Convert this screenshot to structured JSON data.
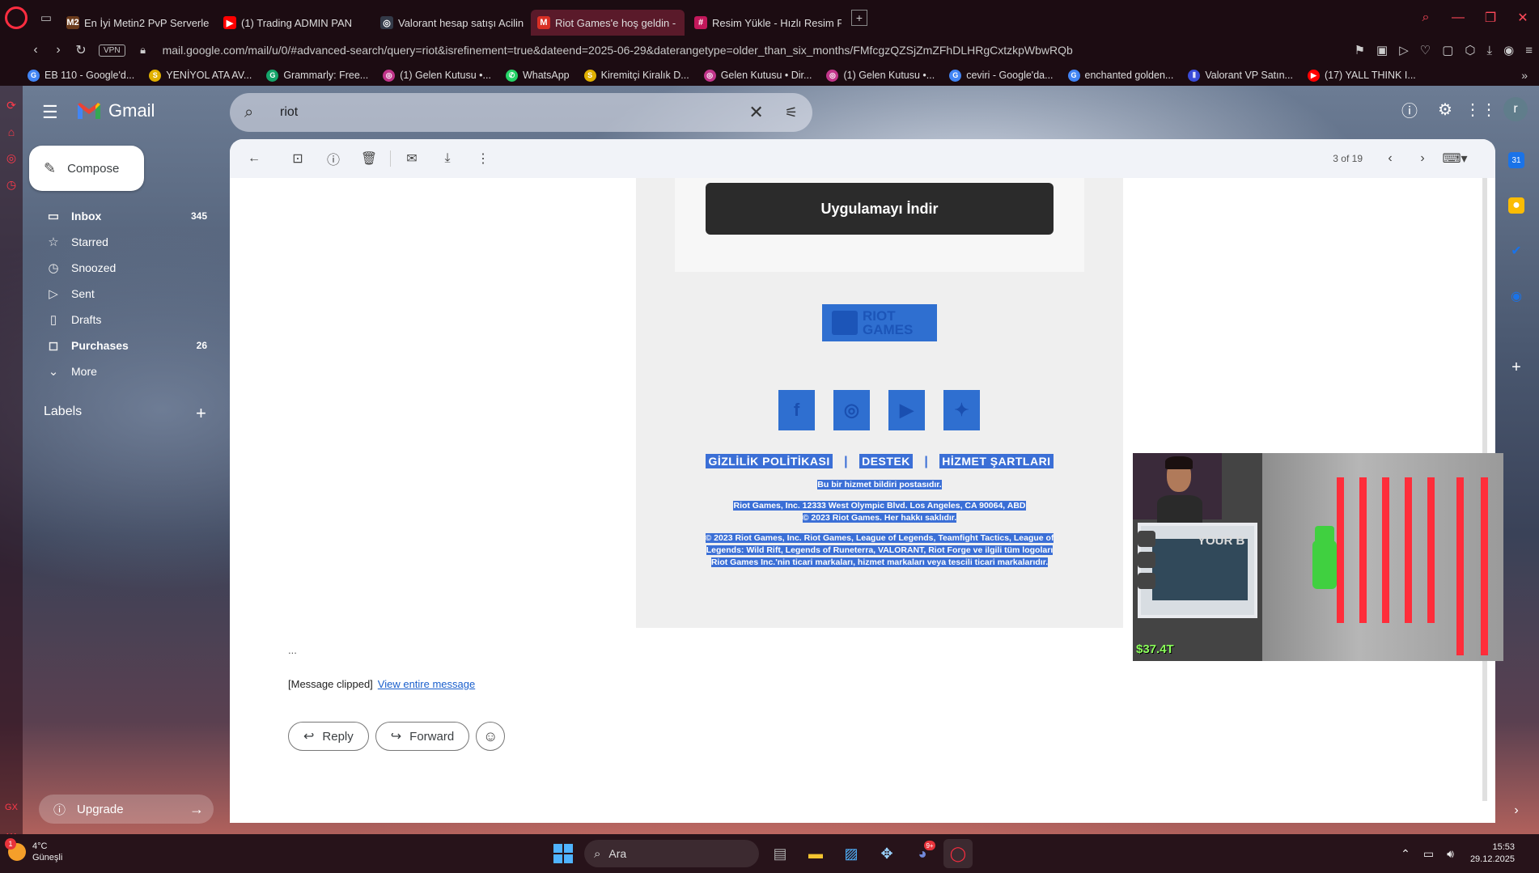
{
  "browser": {
    "tabs": [
      {
        "label": "En İyi Metin2 PvP Serverle",
        "fav": "M2",
        "fav_color": "#6b3b1c",
        "active": false
      },
      {
        "label": "(1) Trading ADMIN PAN",
        "fav": "▶",
        "fav_color": "#ff0000",
        "active": false
      },
      {
        "label": "Valorant hesap satışı Acilin",
        "fav": "◎",
        "fav_color": "#333a48",
        "active": false
      },
      {
        "label": "Riot Games'e hoş geldin -",
        "fav": "M",
        "fav_color": "#d93025",
        "active": true
      },
      {
        "label": "Resim Yükle - Hızlı Resim P",
        "fav": "#",
        "fav_color": "#c2185b",
        "active": false
      }
    ],
    "url": "mail.google.com/mail/u/0/#advanced-search/query=riot&isrefinement=true&dateend=2025-06-29&daterangetype=older_than_six_months/FMfcgzQZSjZmZFhDLHRgCxtzkpWbwRQb",
    "vpn": "VPN",
    "bookmarks": [
      {
        "label": "EB 110 - Google'd...",
        "fav": "G",
        "color": "#4285f4"
      },
      {
        "label": "YENİYOL ATA AV...",
        "fav": "S",
        "color": "#e0b000"
      },
      {
        "label": "Grammarly: Free...",
        "fav": "G",
        "color": "#15a46a"
      },
      {
        "label": "(1) Gelen Kutusu •...",
        "fav": "◎",
        "color": "#c1358a"
      },
      {
        "label": "WhatsApp",
        "fav": "✆",
        "color": "#25d366"
      },
      {
        "label": "Kiremitçi Kiralık D...",
        "fav": "S",
        "color": "#e0b000"
      },
      {
        "label": "Gelen Kutusu • Dir...",
        "fav": "◎",
        "color": "#c1358a"
      },
      {
        "label": "(1) Gelen Kutusu •...",
        "fav": "◎",
        "color": "#c1358a"
      },
      {
        "label": "ceviri - Google'da...",
        "fav": "G",
        "color": "#4285f4"
      },
      {
        "label": "enchanted golden...",
        "fav": "G",
        "color": "#4285f4"
      },
      {
        "label": "Valorant VP Satın...",
        "fav": "⫴",
        "color": "#3a4cd8"
      },
      {
        "label": "(17) YALL THINK I...",
        "fav": "▶",
        "color": "#ff0000"
      }
    ]
  },
  "gmail": {
    "brand": "Gmail",
    "search_query": "riot",
    "compose": "Compose",
    "nav": [
      {
        "label": "Inbox",
        "icon": "inbox-icon",
        "glyph": "▭",
        "count": "345",
        "bold": true
      },
      {
        "label": "Starred",
        "icon": "star-icon",
        "glyph": "☆",
        "count": "",
        "bold": false
      },
      {
        "label": "Snoozed",
        "icon": "clock-icon",
        "glyph": "◷",
        "count": "",
        "bold": false
      },
      {
        "label": "Sent",
        "icon": "send-icon",
        "glyph": "▷",
        "count": "",
        "bold": false
      },
      {
        "label": "Drafts",
        "icon": "draft-icon",
        "glyph": "▯",
        "count": "",
        "bold": false
      },
      {
        "label": "Purchases",
        "icon": "bag-icon",
        "glyph": "◻",
        "count": "26",
        "bold": true
      },
      {
        "label": "More",
        "icon": "chevron-down-icon",
        "glyph": "⌄",
        "count": "",
        "bold": false
      }
    ],
    "labels_title": "Labels",
    "upgrade": "Upgrade",
    "pager": "3 of 19"
  },
  "email": {
    "download_button": "Uygulamayı İndir",
    "riot_logo": "RIOT GAMES",
    "links": [
      "GİZLİLİK POLİTİKASI",
      "DESTEK",
      "HİZMET ŞARTLARI"
    ],
    "link_sep": "|",
    "service_notice": "Bu bir hizmet bildiri postasıdır.",
    "address": "Riot Games, Inc. 12333 West Olympic Blvd. Los Angeles, CA 90064, ABD",
    "copyright": "© 2023 Riot Games. Her hakkı saklıdır.",
    "trademarks": "© 2023 Riot Games, Inc. Riot Games, League of Legends, Teamfight Tactics, League of Legends: Wild Rift, Legends of Runeterra, VALORANT, Riot Forge ve ilgili tüm logoları Riot Games Inc.'nin ticari markaları, hizmet markaları veya tescili ticari markalarıdır.",
    "ellipsis": "...",
    "clipped_text": "[Message clipped]",
    "view_entire": "View entire message",
    "reply": "Reply",
    "forward": "Forward"
  },
  "pip": {
    "game_text": "YOUR B",
    "money": "$37.4T"
  },
  "taskbar": {
    "temp": "4°C",
    "weather": "Güneşli",
    "weather_badge": "1",
    "search": "Ara",
    "discord_badge": "9+",
    "time": "15:53",
    "date": "29.12.2025"
  }
}
